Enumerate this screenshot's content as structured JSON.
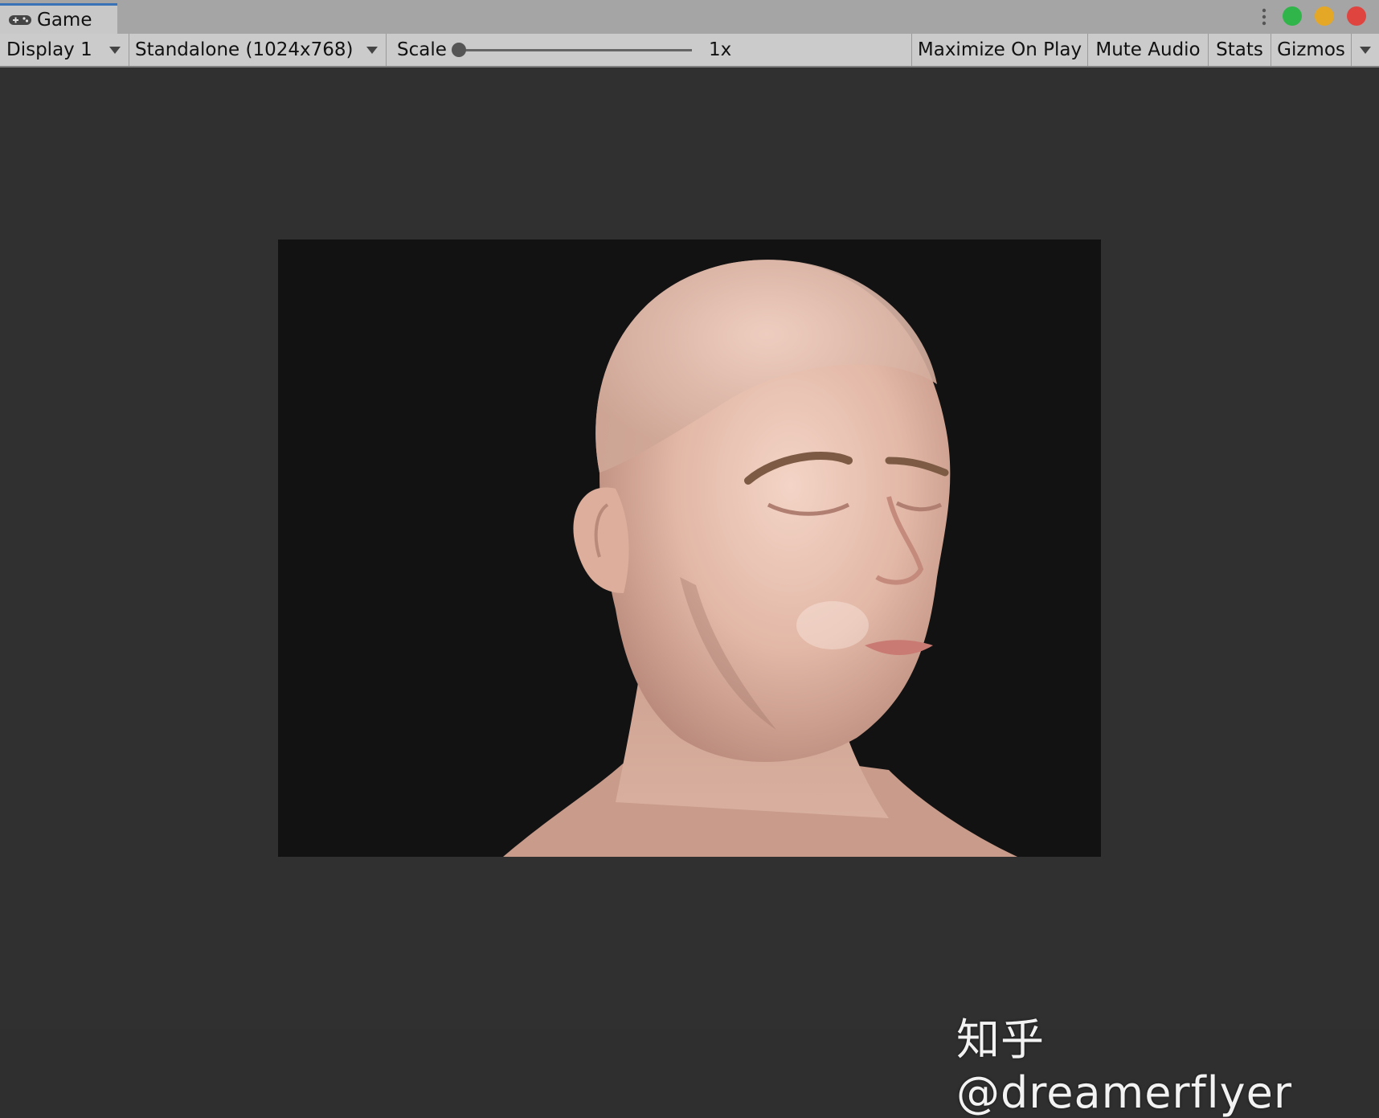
{
  "tab": {
    "label": "Game",
    "icon": "gamepad-icon"
  },
  "window_controls": {
    "menu_icon": "kebab-menu-icon",
    "colors": {
      "green": "#2fb54a",
      "yellow": "#e4a826",
      "red": "#e0443f"
    }
  },
  "toolbar": {
    "display": "Display 1",
    "resolution": "Standalone (1024x768)",
    "scale_label": "Scale",
    "scale_value": "1x",
    "scale_slider_level": 0,
    "maximize_on_play": "Maximize On Play",
    "mute_audio": "Mute Audio",
    "stats": "Stats",
    "gizmos": "Gizmos"
  },
  "viewport": {
    "background": "#303030",
    "render_background": "#131212"
  },
  "watermark": "知乎 @dreamerflyer"
}
